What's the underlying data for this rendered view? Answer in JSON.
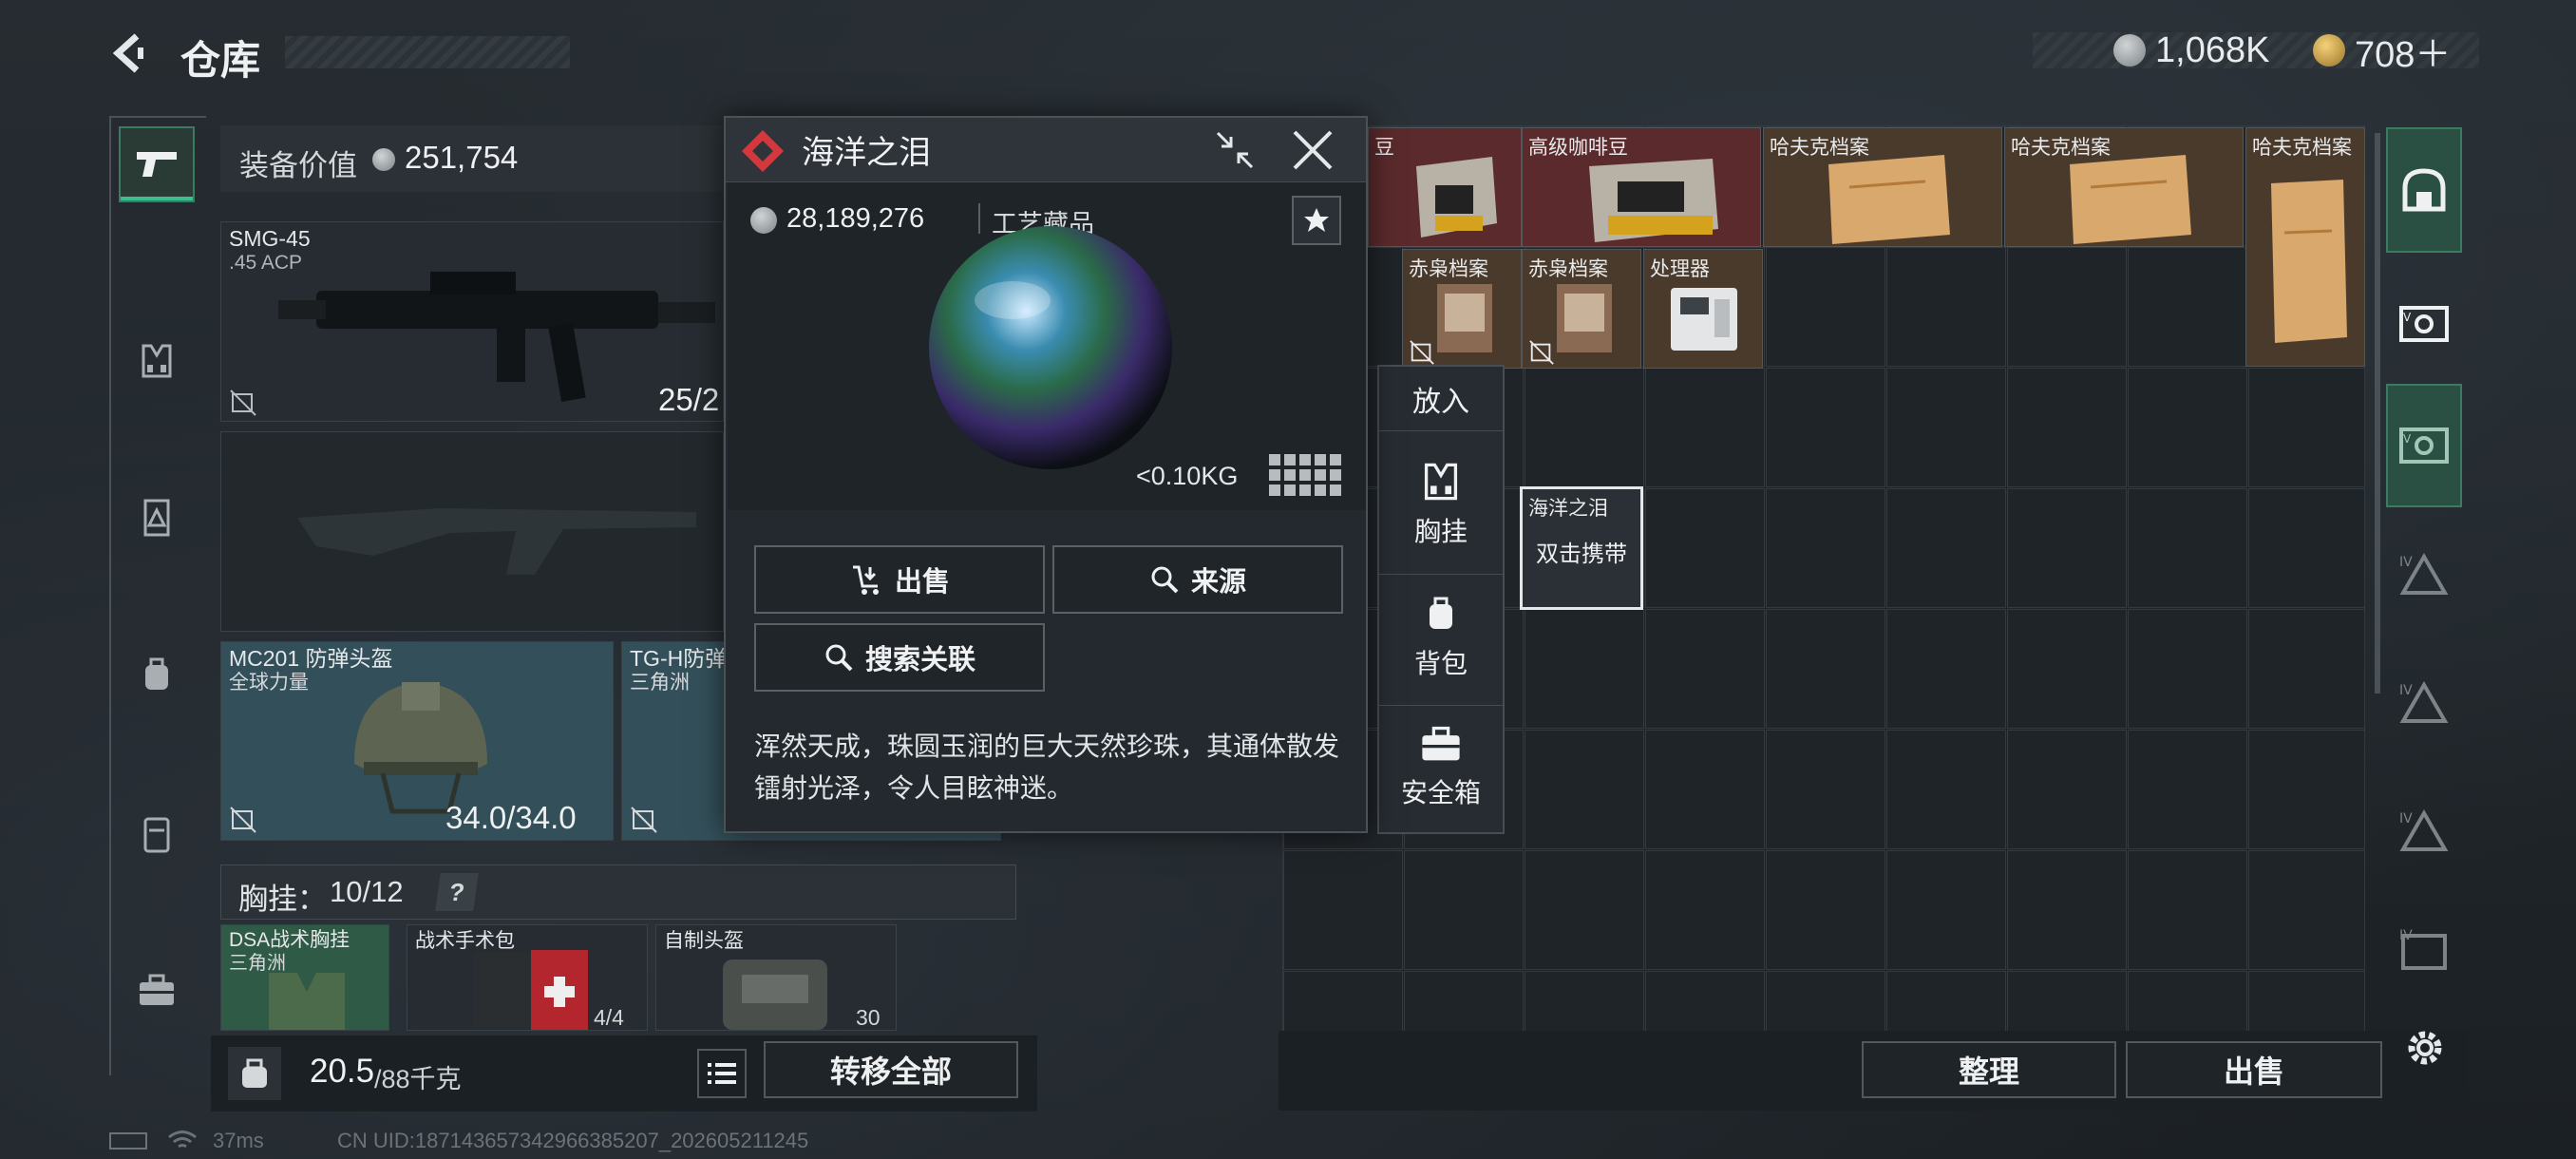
{
  "header": {
    "title": "仓库",
    "currency_silver": "1,068K",
    "currency_gold": "708＋"
  },
  "loadout": {
    "value_label": "装备价值",
    "value": "251,754",
    "weapon1": {
      "name": "SMG-45",
      "caliber": ".45 ACP",
      "ammo": "25/2"
    },
    "helmet": {
      "name": "MC201 防弹头盔",
      "origin": "全球力量",
      "durability": "34.0/34.0"
    },
    "armor": {
      "name": "TG-H防弹",
      "origin": "三角洲"
    },
    "chestrig": {
      "label": "胸挂：",
      "count": "10/12",
      "help": "?"
    },
    "items": [
      {
        "name": "DSA战术胸挂",
        "sub": "三角洲"
      },
      {
        "name": "战术手术包",
        "count": "4/4"
      },
      {
        "name": "自制头盔",
        "count": "30"
      }
    ]
  },
  "popup": {
    "title": "海洋之泪",
    "price": "28,189,276",
    "category": "工艺藏品",
    "weight": "<0.10KG",
    "sell": "出售",
    "source": "来源",
    "search_related": "搜索关联",
    "description": "浑然天成，珠圆玉润的巨大天然珍珠，其通体散发镭射光泽，令人目眩神迷。"
  },
  "putin": {
    "title": "放入",
    "options": [
      "胸挂",
      "背包",
      "安全箱"
    ]
  },
  "stash": {
    "items": [
      {
        "name": "豆"
      },
      {
        "name": "高级咖啡豆"
      },
      {
        "name": "哈夫克档案"
      },
      {
        "name": "哈夫克档案"
      },
      {
        "name": "哈夫克档案"
      },
      {
        "name": "赤枭档案"
      },
      {
        "name": "赤枭档案"
      },
      {
        "name": "处理器"
      }
    ],
    "selected": {
      "name": "海洋之泪",
      "hint": "双击携带"
    }
  },
  "bottom": {
    "weight": "20.5",
    "weight_max": "/88千克",
    "transfer_all": "转移全部",
    "arrange": "整理",
    "sell": "出售"
  },
  "status": {
    "ping": "37ms",
    "uid": "CN UID:187143657342966385207_202605211245"
  },
  "colors": {
    "accent_green": "#3bbf8c",
    "item_red": "#5a2a2c",
    "item_brown": "#4a3a2c"
  }
}
